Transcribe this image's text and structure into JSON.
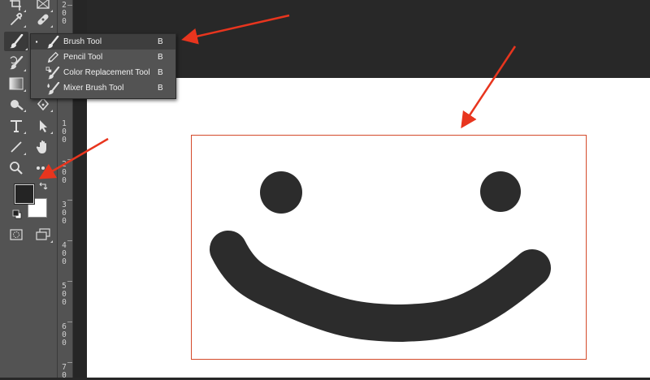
{
  "menu": {
    "items": [
      {
        "label": "Brush Tool",
        "shortcut": "B",
        "icon": "brush-icon"
      },
      {
        "label": "Pencil Tool",
        "shortcut": "B",
        "icon": "pencil-icon"
      },
      {
        "label": "Color Replacement Tool",
        "shortcut": "B",
        "icon": "color-replacement-icon"
      },
      {
        "label": "Mixer Brush Tool",
        "shortcut": "B",
        "icon": "mixer-brush-icon"
      }
    ],
    "active_marker": "▪"
  },
  "ruler": {
    "labels": [
      "2\n0\n0",
      "1\n0\n0",
      "2\n0\n0",
      "3\n0\n0",
      "4\n0\n0",
      "5\n0\n0",
      "6\n0\n0",
      "7\n0"
    ]
  },
  "colors": {
    "foreground": "#242424",
    "background": "#ffffff",
    "annotation_arrow": "#e8351e",
    "canvas_frame": "#d44a2a"
  }
}
